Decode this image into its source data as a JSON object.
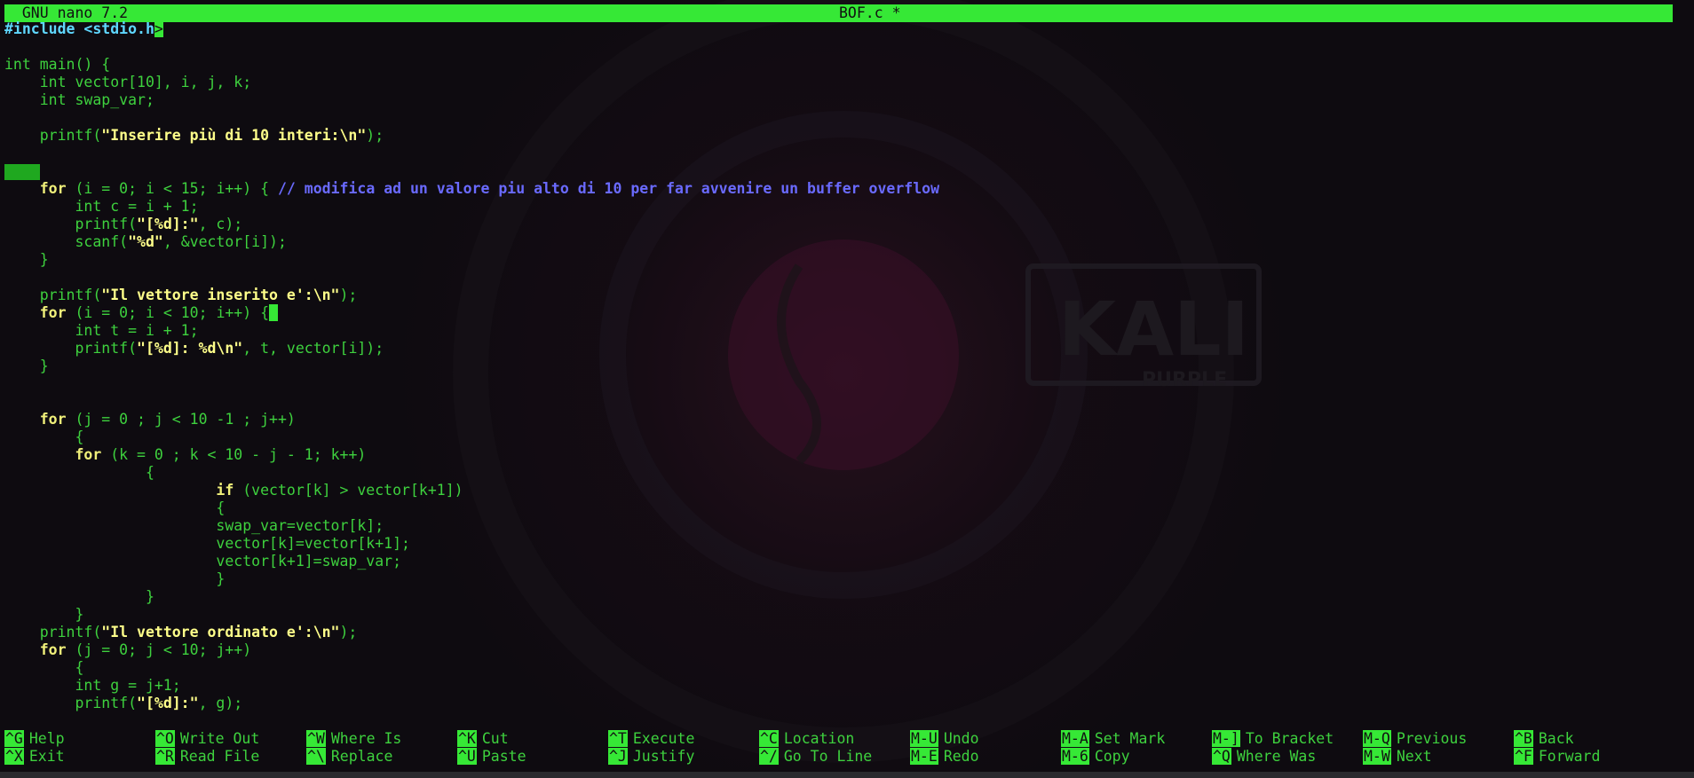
{
  "titlebar": {
    "app": "  GNU nano 7.2",
    "filename": "BOF.c *"
  },
  "editor": {
    "lines": [
      [
        {
          "t": "#include <stdio.h",
          "c": "inc"
        },
        {
          "t": ">",
          "c": "cursor"
        }
      ],
      [],
      [
        {
          "t": "int main() {",
          "c": ""
        }
      ],
      [
        {
          "t": "    int vector[10], i, j, k;",
          "c": ""
        }
      ],
      [
        {
          "t": "    int swap_var;",
          "c": ""
        }
      ],
      [],
      [
        {
          "t": "    printf(",
          "c": ""
        },
        {
          "t": "\"Inserire più di 10 interi:\\n\"",
          "c": "str"
        },
        {
          "t": ");",
          "c": ""
        }
      ],
      [],
      [
        {
          "t": "",
          "c": "marked"
        }
      ],
      [
        {
          "t": "    ",
          "c": ""
        },
        {
          "t": "for",
          "c": "kw"
        },
        {
          "t": " (i = 0; i < 15; i++) { ",
          "c": ""
        },
        {
          "t": "// modifica ad un valore piu alto di 10 per far avvenire un buffer overflow",
          "c": "cmt"
        }
      ],
      [
        {
          "t": "        int c = i + 1;",
          "c": ""
        }
      ],
      [
        {
          "t": "        printf(",
          "c": ""
        },
        {
          "t": "\"[%d]:\"",
          "c": "str"
        },
        {
          "t": ", c);",
          "c": ""
        }
      ],
      [
        {
          "t": "        scanf(",
          "c": ""
        },
        {
          "t": "\"%d\"",
          "c": "str"
        },
        {
          "t": ", &vector[i]);",
          "c": ""
        }
      ],
      [
        {
          "t": "    }",
          "c": ""
        }
      ],
      [],
      [
        {
          "t": "    printf(",
          "c": ""
        },
        {
          "t": "\"Il vettore inserito e':\\n\"",
          "c": "str"
        },
        {
          "t": ");",
          "c": ""
        }
      ],
      [
        {
          "t": "    ",
          "c": ""
        },
        {
          "t": "for",
          "c": "kw"
        },
        {
          "t": " (i = 0; i < 10; i++) {",
          "c": ""
        },
        {
          "t": " ",
          "c": "cursor"
        }
      ],
      [
        {
          "t": "        int t = i + 1;",
          "c": ""
        }
      ],
      [
        {
          "t": "        printf(",
          "c": ""
        },
        {
          "t": "\"[%d]: %d\\n\"",
          "c": "str"
        },
        {
          "t": ", t, vector[i]);",
          "c": ""
        }
      ],
      [
        {
          "t": "    }",
          "c": ""
        }
      ],
      [],
      [],
      [
        {
          "t": "    ",
          "c": ""
        },
        {
          "t": "for",
          "c": "kw"
        },
        {
          "t": " (j = 0 ; j < 10 -1 ; j++)",
          "c": ""
        }
      ],
      [
        {
          "t": "        {",
          "c": ""
        }
      ],
      [
        {
          "t": "        ",
          "c": ""
        },
        {
          "t": "for",
          "c": "kw"
        },
        {
          "t": " (k = 0 ; k < 10 - j - 1; k++)",
          "c": ""
        }
      ],
      [
        {
          "t": "                {",
          "c": ""
        }
      ],
      [
        {
          "t": "                        ",
          "c": ""
        },
        {
          "t": "if",
          "c": "kw"
        },
        {
          "t": " (vector[k] > vector[k+1])",
          "c": ""
        }
      ],
      [
        {
          "t": "                        {",
          "c": ""
        }
      ],
      [
        {
          "t": "                        swap_var=vector[k];",
          "c": ""
        }
      ],
      [
        {
          "t": "                        vector[k]=vector[k+1];",
          "c": ""
        }
      ],
      [
        {
          "t": "                        vector[k+1]=swap_var;",
          "c": ""
        }
      ],
      [
        {
          "t": "                        }",
          "c": ""
        }
      ],
      [
        {
          "t": "                }",
          "c": ""
        }
      ],
      [
        {
          "t": "        }",
          "c": ""
        }
      ],
      [
        {
          "t": "    printf(",
          "c": ""
        },
        {
          "t": "\"Il vettore ordinato e':\\n\"",
          "c": "str"
        },
        {
          "t": ");",
          "c": ""
        }
      ],
      [
        {
          "t": "    ",
          "c": ""
        },
        {
          "t": "for",
          "c": "kw"
        },
        {
          "t": " (j = 0; j < 10; j++)",
          "c": ""
        }
      ],
      [
        {
          "t": "        {",
          "c": ""
        }
      ],
      [
        {
          "t": "        int g = j+1;",
          "c": ""
        }
      ],
      [
        {
          "t": "        printf(",
          "c": ""
        },
        {
          "t": "\"[%d]:\"",
          "c": "str"
        },
        {
          "t": ", g);",
          "c": ""
        }
      ]
    ]
  },
  "shortcuts": {
    "row1": [
      {
        "key": "^G",
        "label": "Help"
      },
      {
        "key": "^O",
        "label": "Write Out"
      },
      {
        "key": "^W",
        "label": "Where Is"
      },
      {
        "key": "^K",
        "label": "Cut"
      },
      {
        "key": "^T",
        "label": "Execute"
      },
      {
        "key": "^C",
        "label": "Location"
      },
      {
        "key": "M-U",
        "label": "Undo"
      },
      {
        "key": "M-A",
        "label": "Set Mark"
      },
      {
        "key": "M-]",
        "label": "To Bracket"
      },
      {
        "key": "M-Q",
        "label": "Previous"
      },
      {
        "key": "^B",
        "label": "Back"
      }
    ],
    "row2": [
      {
        "key": "^X",
        "label": "Exit"
      },
      {
        "key": "^R",
        "label": "Read File"
      },
      {
        "key": "^\\",
        "label": "Replace"
      },
      {
        "key": "^U",
        "label": "Paste"
      },
      {
        "key": "^J",
        "label": "Justify"
      },
      {
        "key": "^/",
        "label": "Go To Line"
      },
      {
        "key": "M-E",
        "label": "Redo"
      },
      {
        "key": "M-6",
        "label": "Copy"
      },
      {
        "key": "^Q",
        "label": "Where Was"
      },
      {
        "key": "M-W",
        "label": "Next"
      },
      {
        "key": "^F",
        "label": "Forward"
      }
    ]
  },
  "wallpaper": {
    "logo_text": "KALI",
    "logo_subtext": "PURPLE"
  },
  "colors": {
    "accent": "#36e836",
    "text": "#3ed13e",
    "keyword": "#f0f07a",
    "string": "#ffff8a",
    "include": "#5fd7ff",
    "comment": "#6a6aff",
    "background": "#0e0b10"
  }
}
